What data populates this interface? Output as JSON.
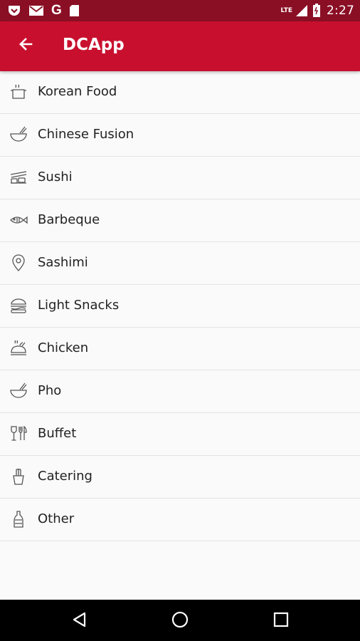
{
  "status_bar": {
    "time": "2:27",
    "network_label": "LTE",
    "icons": [
      "pocket-icon",
      "mail-icon",
      "google-icon",
      "sd-card-icon",
      "signal-icon",
      "battery-icon"
    ],
    "google_letter": "G"
  },
  "app_bar": {
    "title": "DCApp",
    "back_icon": "arrow-left-icon",
    "color": "#c8102e"
  },
  "categories": [
    {
      "label": "Korean Food",
      "icon": "pot-icon"
    },
    {
      "label": "Chinese Fusion",
      "icon": "bowl-icon"
    },
    {
      "label": "Sushi",
      "icon": "sushi-icon"
    },
    {
      "label": "Barbeque",
      "icon": "fish-icon"
    },
    {
      "label": "Sashimi",
      "icon": "location-pin-icon"
    },
    {
      "label": "Light Snacks",
      "icon": "burger-icon"
    },
    {
      "label": "Chicken",
      "icon": "roast-chicken-icon"
    },
    {
      "label": "Pho",
      "icon": "bowl-icon"
    },
    {
      "label": "Buffet",
      "icon": "wine-cutlery-icon"
    },
    {
      "label": "Catering",
      "icon": "utensils-cup-icon"
    },
    {
      "label": "Other",
      "icon": "bottle-icon"
    }
  ],
  "nav_bar": {
    "buttons": [
      "back-triangle-icon",
      "home-circle-icon",
      "recents-square-icon"
    ]
  }
}
